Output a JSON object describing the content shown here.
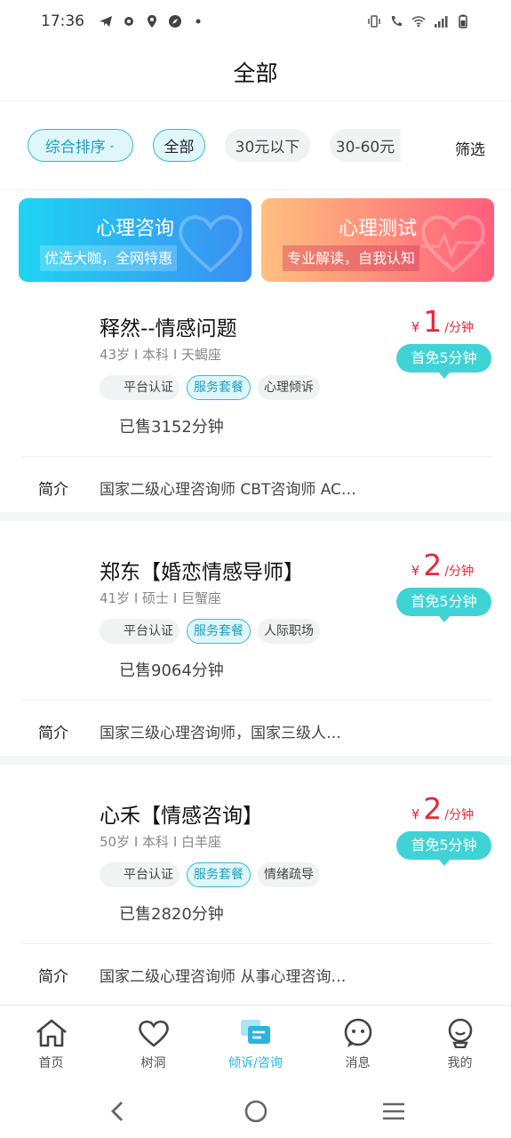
{
  "status_bar": {
    "time": "17:36"
  },
  "header": {
    "title": "全部"
  },
  "filters": {
    "sort_label": "综合排序",
    "chips": [
      "全部",
      "30元以下",
      "30-60元"
    ],
    "filter_label": "筛选"
  },
  "banners": [
    {
      "title": "心理咨询",
      "subtitle": "优选大咖，全网特惠"
    },
    {
      "title": "心理测试",
      "subtitle": "专业解读，自我认知"
    }
  ],
  "counselors": [
    {
      "name": "释然--情感问题",
      "meta": "43岁 I 本科 I 天蝎座",
      "tags": [
        "平台认证",
        "服务套餐",
        "心理倾诉"
      ],
      "sold": "已售3152分钟",
      "price_symbol": "¥",
      "price": "1",
      "price_unit": "/分钟",
      "free_badge": "首免5分钟",
      "intro_label": "简介",
      "intro": "国家二级心理咨询师 CBT咨询师 AC…"
    },
    {
      "name": "郑东【婚恋情感导师】",
      "meta": "41岁 I 硕士 I 巨蟹座",
      "tags": [
        "平台认证",
        "服务套餐",
        "人际职场"
      ],
      "sold": "已售9064分钟",
      "price_symbol": "¥",
      "price": "2",
      "price_unit": "/分钟",
      "free_badge": "首免5分钟",
      "intro_label": "简介",
      "intro": "国家三级心理咨询师，国家三级人…"
    },
    {
      "name": "心禾【情感咨询】",
      "meta": "50岁 I 本科 I 白羊座",
      "tags": [
        "平台认证",
        "服务套餐",
        "情绪疏导"
      ],
      "sold": "已售2820分钟",
      "price_symbol": "¥",
      "price": "2",
      "price_unit": "/分钟",
      "free_badge": "首免5分钟",
      "intro_label": "简介",
      "intro": "国家二级心理咨询师 从事心理咨询…"
    }
  ],
  "tabbar": {
    "items": [
      {
        "label": "首页",
        "icon": "home-icon"
      },
      {
        "label": "树洞",
        "icon": "heart-icon"
      },
      {
        "label": "倾诉/咨询",
        "icon": "chat-icon"
      },
      {
        "label": "消息",
        "icon": "message-icon"
      },
      {
        "label": "我的",
        "icon": "profile-icon"
      }
    ],
    "active_index": 2
  },
  "colors": {
    "accent": "#35b9d4",
    "price": "#e5283c",
    "free_badge": "#3fd3d6",
    "active_tab": "#2ab5e0"
  }
}
